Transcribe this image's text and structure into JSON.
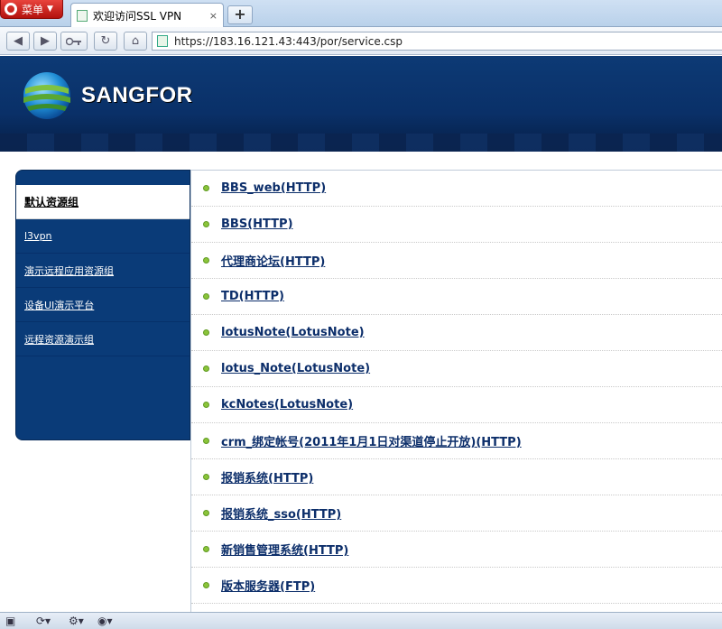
{
  "browser": {
    "menu_label": "菜单",
    "tab_title": "欢迎访问SSL VPN",
    "tab_close": "×",
    "new_tab": "+",
    "url": "https://183.16.121.43:443/por/service.csp"
  },
  "header": {
    "brand": "SANGFOR"
  },
  "sidebar": {
    "items": [
      {
        "label": "默认资源组"
      },
      {
        "label": "l3vpn"
      },
      {
        "label": "演示远程应用资源组"
      },
      {
        "label": "设备UI演示平台"
      },
      {
        "label": "远程资源演示组"
      }
    ]
  },
  "resources": [
    {
      "label": "BBS_web(HTTP)"
    },
    {
      "label": "BBS(HTTP)"
    },
    {
      "label": "代理商论坛(HTTP)"
    },
    {
      "label": "TD(HTTP)"
    },
    {
      "label": "lotusNote(LotusNote)"
    },
    {
      "label": "lotus_Note(LotusNote)"
    },
    {
      "label": "kcNotes(LotusNote)"
    },
    {
      "label": "crm_绑定帐号(2011年1月1日对渠道停止开放)(HTTP)"
    },
    {
      "label": "报销系统(HTTP)"
    },
    {
      "label": "报销系统_sso(HTTP)"
    },
    {
      "label": "新销售管理系统(HTTP)"
    },
    {
      "label": "版本服务器(FTP)"
    }
  ],
  "colors": {
    "banner": "#0a3068",
    "sidebar": "#0a3b78",
    "link": "#0c2e6a",
    "bullet": "#8bc43a"
  }
}
